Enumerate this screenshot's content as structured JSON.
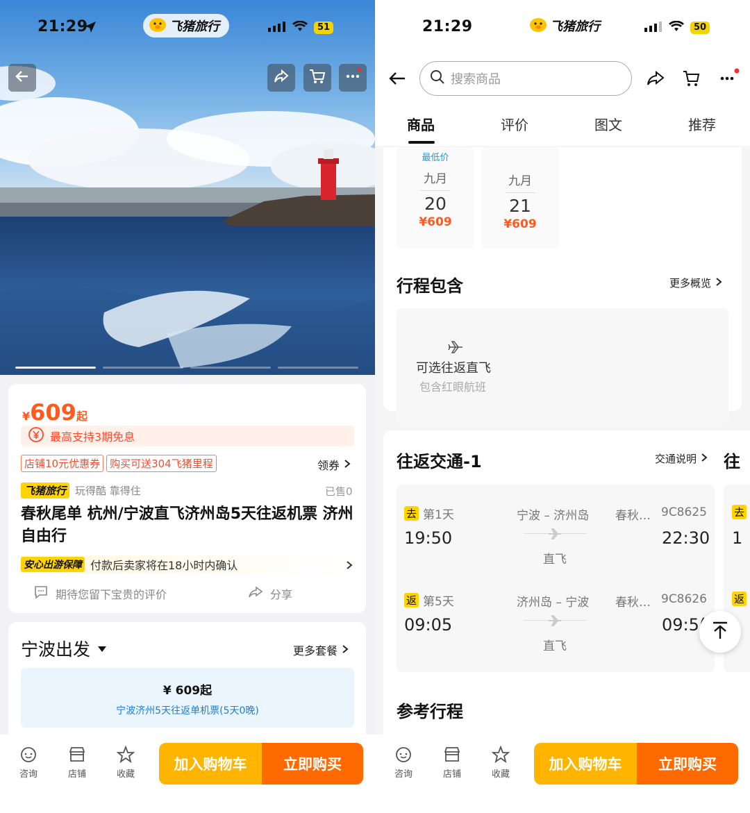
{
  "status": {
    "time_left": "21:29",
    "time_right": "21:29",
    "battery_left": "51",
    "battery_right": "50",
    "app_name": "飞猪旅行"
  },
  "left": {
    "price_symbol": "¥",
    "price": "609",
    "price_suffix": "起",
    "installment": "最高支持3期免息",
    "coupon_tags": [
      "店铺10元优惠券",
      "购买可送304飞猪里程"
    ],
    "coupon_link": "领券",
    "seller_badge": "飞猪旅行",
    "seller_slogan": "玩得酷 靠得住",
    "sold": "已售0",
    "title": "春秋尾单 杭州/宁波直飞济州岛5天往返机票 济州自由行",
    "guarantee_badge": "安心出游保障",
    "guarantee_text": "付款后卖家将在18小时内确认",
    "review_prompt": "期待您留下宝贵的评价",
    "share": "分享",
    "departure": "宁波出发",
    "more_packages": "更多套餐",
    "package_price": "¥ 609起",
    "package_desc": "宁波济州5天往返单机票(5天0晚)"
  },
  "right": {
    "search_placeholder": "搜索商品",
    "tabs": [
      "商品",
      "评价",
      "图文",
      "推荐"
    ],
    "active_tab": "商品",
    "lowest_price_label": "最低价",
    "dates": [
      {
        "month": "九月",
        "day": "20",
        "price": "¥609"
      },
      {
        "month": "九月",
        "day": "21",
        "price": "¥609"
      }
    ],
    "itinerary_title": "行程包含",
    "more_overview": "更多概览",
    "flight_option": "可选往返直飞",
    "flight_note": "包含红眼航班",
    "transport_title": "往返交通-1",
    "transport_note": "交通说明",
    "transport_peek": "往",
    "legs": [
      {
        "badge": "去",
        "day": "第1天",
        "route": "宁波 – 济州岛",
        "airline": "春秋…",
        "flight": "9C8625",
        "dep": "19:50",
        "arr": "22:30",
        "type": "直飞",
        "peek": "1"
      },
      {
        "badge": "返",
        "day": "第5天",
        "route": "济州岛 – 宁波",
        "airline": "春秋…",
        "flight": "9C8626",
        "dep": "09:05",
        "arr": "09:5(",
        "type": "直飞",
        "peek": ""
      }
    ],
    "reference_title": "参考行程"
  },
  "bottom": {
    "consult": "咨询",
    "shop": "店铺",
    "favorite": "收藏",
    "add_cart": "加入购物车",
    "buy_now": "立即购买"
  },
  "colors": {
    "accent_orange": "#ff6a00",
    "cart_yellow": "#ffb400",
    "price_red": "#ff5a1f"
  }
}
